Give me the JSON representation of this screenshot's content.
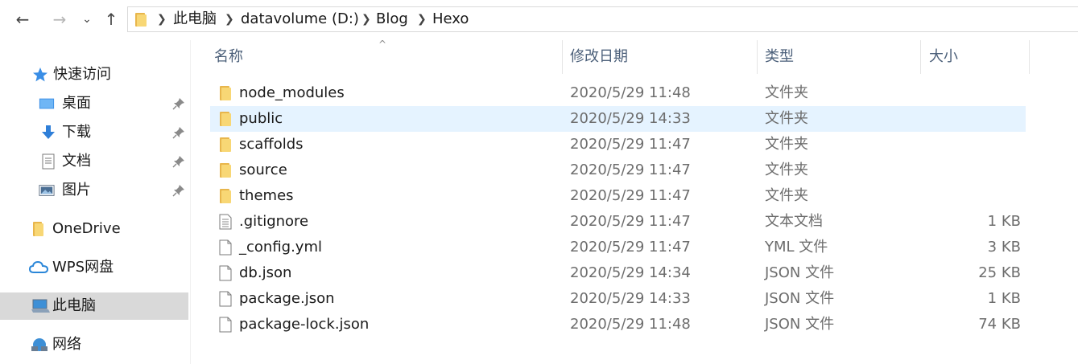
{
  "address_bar": {
    "path": [
      "此电脑",
      "datavolume (D:)",
      "Blog",
      "Hexo"
    ]
  },
  "nav_buttons": {
    "back": "←",
    "forward": "→",
    "recent": "⌄",
    "up": "↑"
  },
  "sidebar": {
    "quick_access": "快速访问",
    "pinned": [
      {
        "label": "桌面",
        "icon": "desktop-icon"
      },
      {
        "label": "下载",
        "icon": "download-icon"
      },
      {
        "label": "文档",
        "icon": "document-icon"
      },
      {
        "label": "图片",
        "icon": "pictures-icon"
      }
    ],
    "onedrive": "OneDrive",
    "wps": "WPS网盘",
    "this_pc": "此电脑",
    "network": "网络"
  },
  "columns": {
    "name": "名称",
    "date": "修改日期",
    "type": "类型",
    "size": "大小"
  },
  "files": [
    {
      "name": "node_modules",
      "date": "2020/5/29 11:48",
      "type": "文件夹",
      "size": "",
      "kind": "folder"
    },
    {
      "name": "public",
      "date": "2020/5/29 14:33",
      "type": "文件夹",
      "size": "",
      "kind": "folder",
      "selected": true
    },
    {
      "name": "scaffolds",
      "date": "2020/5/29 11:47",
      "type": "文件夹",
      "size": "",
      "kind": "folder"
    },
    {
      "name": "source",
      "date": "2020/5/29 11:47",
      "type": "文件夹",
      "size": "",
      "kind": "folder"
    },
    {
      "name": "themes",
      "date": "2020/5/29 11:47",
      "type": "文件夹",
      "size": "",
      "kind": "folder"
    },
    {
      "name": ".gitignore",
      "date": "2020/5/29 11:47",
      "type": "文本文档",
      "size": "1 KB",
      "kind": "text"
    },
    {
      "name": "_config.yml",
      "date": "2020/5/29 11:47",
      "type": "YML 文件",
      "size": "3 KB",
      "kind": "file"
    },
    {
      "name": "db.json",
      "date": "2020/5/29 14:34",
      "type": "JSON 文件",
      "size": "25 KB",
      "kind": "file"
    },
    {
      "name": "package.json",
      "date": "2020/5/29 14:33",
      "type": "JSON 文件",
      "size": "1 KB",
      "kind": "file"
    },
    {
      "name": "package-lock.json",
      "date": "2020/5/29 11:48",
      "type": "JSON 文件",
      "size": "74 KB",
      "kind": "file"
    }
  ],
  "colors": {
    "folder": "#f8d775",
    "selected_row": "#e5f3ff",
    "selected_nav": "#d9d9d9",
    "header_text": "#4c607a"
  }
}
